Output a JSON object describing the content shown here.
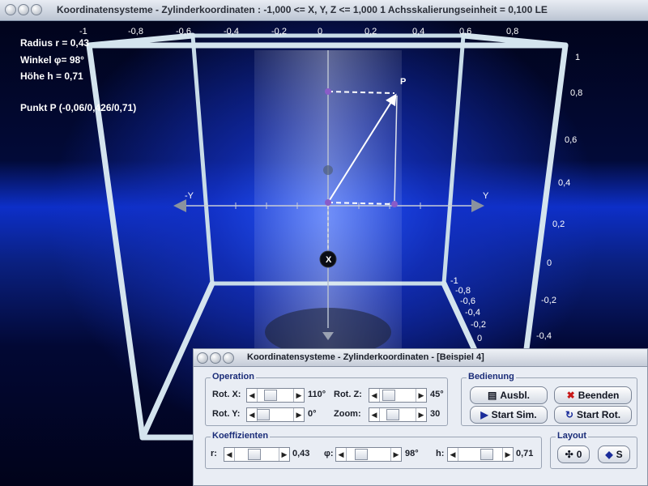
{
  "window": {
    "title": "Koordinatensysteme - Zylinderkoordinaten :     -1,000 <= X, Y, Z <= 1,000    1 Achsskalierungseinheit = 0,100 LE"
  },
  "info": {
    "radius": "Radius r = 0,43",
    "winkel": "Winkel φ= 98°",
    "hoehe": "Höhe h = 0,71",
    "punkt": "Punkt P (-0,06/0,426/0,71)"
  },
  "scene": {
    "top_ticks": [
      "-1",
      "-0,8",
      "-0,6",
      "-0,4",
      "-0,2",
      "0",
      "0,2",
      "0,4",
      "0,6",
      "0,8"
    ],
    "right_ticks": [
      "1",
      "0,8",
      "0,6",
      "0,4",
      "0,2",
      "0",
      "-0,2",
      "-0,4"
    ],
    "depth_ticks": [
      "-1",
      "-0,8",
      "-0,6",
      "-0,4",
      "-0,2",
      "0"
    ],
    "axis_y_neg": "-Y",
    "axis_y_pos": "Y",
    "axis_x": "X",
    "point_label": "P"
  },
  "panel": {
    "title": "Koordinatensysteme - Zylinderkoordinaten - [Beispiel 4]",
    "operation": {
      "label": "Operation",
      "rot_x_label": "Rot. X:",
      "rot_x_value": "110°",
      "rot_x_level": 0.3,
      "rot_y_label": "Rot. Y:",
      "rot_y_value": "0°",
      "rot_y_level": 0.0,
      "rot_z_label": "Rot. Z:",
      "rot_z_value": "45°",
      "rot_z_level": 0.125,
      "zoom_label": "Zoom:",
      "zoom_value": "30",
      "zoom_level": 0.3
    },
    "bedienung": {
      "label": "Bedienung",
      "ausbl_label": "Ausbl.",
      "beenden_label": "Beenden",
      "start_sim_label": "Start Sim.",
      "start_rot_label": "Start Rot."
    },
    "koeffizienten": {
      "label": "Koeffizienten",
      "r_label": "r:",
      "r_value": "0,43",
      "r_level": 0.43,
      "phi_label": "φ:",
      "phi_value": "98°",
      "phi_level": 0.27,
      "h_label": "h:",
      "h_value": "0,71",
      "h_level": 0.71
    },
    "layout": {
      "label": "Layout",
      "btn_zero_label": "0",
      "btn_s_label": "S"
    }
  },
  "colors": {
    "frame": "#c8dce8",
    "accent": "#1a2c78",
    "point": "#8a5cc8"
  }
}
